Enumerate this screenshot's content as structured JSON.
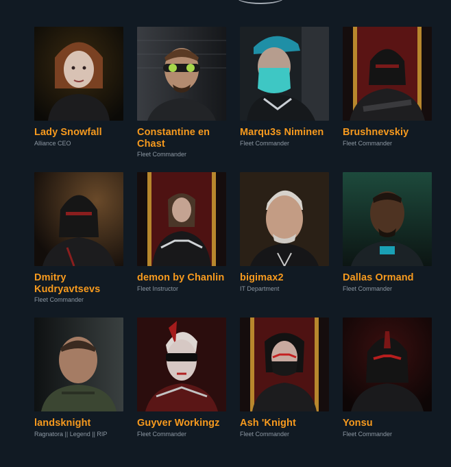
{
  "members": [
    {
      "name": "Lady Snowfall",
      "role": "Alliance CEO"
    },
    {
      "name": "Constantine en Chast",
      "role": "Fleet Commander"
    },
    {
      "name": "Marqu3s Niminen",
      "role": "Fleet Commander"
    },
    {
      "name": "Brushnevskiy",
      "role": "Fleet Commander"
    },
    {
      "name": "Dmitry Kudryavtsevs",
      "role": "Fleet Commander"
    },
    {
      "name": "demon by Chanlin",
      "role": "Fleet Instructor"
    },
    {
      "name": "bigimax2",
      "role": "IT Department"
    },
    {
      "name": "Dallas Ormand",
      "role": "Fleet Commander"
    },
    {
      "name": "landsknight",
      "role": "Ragnatora || Legend || RIP"
    },
    {
      "name": "Guyver Workingz",
      "role": "Fleet Commander"
    },
    {
      "name": "Ash 'Knight",
      "role": "Fleet Commander"
    },
    {
      "name": "Yonsu",
      "role": "Fleet Commander"
    }
  ],
  "colors": {
    "background": "#111a23",
    "name": "#f79a1e",
    "role": "#8d98a3"
  }
}
